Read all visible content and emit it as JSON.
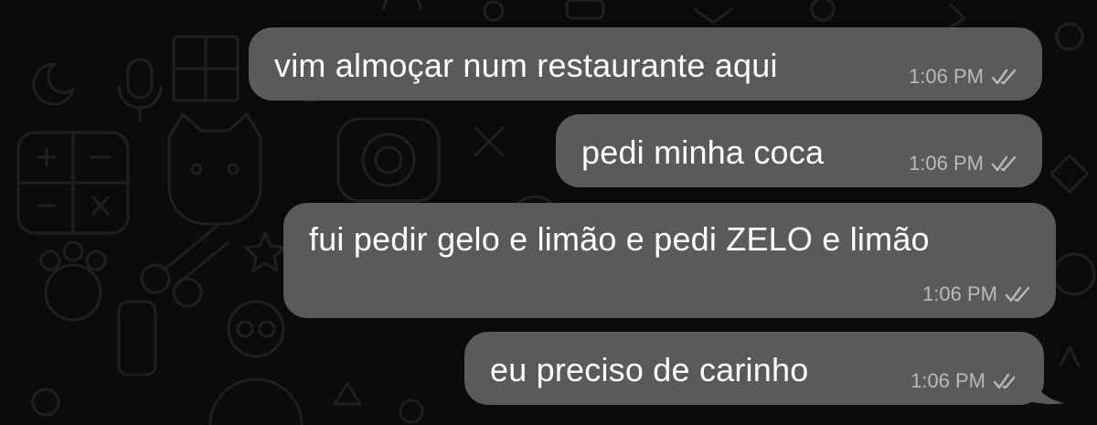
{
  "chat": {
    "messages": [
      {
        "text": "vim almoçar num restaurante aqui",
        "time": "1:06 PM",
        "status_icon": "double-check-icon"
      },
      {
        "text": "pedi minha coca",
        "time": "1:06 PM",
        "status_icon": "double-check-icon"
      },
      {
        "text": "fui pedir gelo e limão e pedi ZELO e limão",
        "time": "1:06 PM",
        "status_icon": "double-check-icon"
      },
      {
        "text": "eu preciso de carinho",
        "time": "1:06 PM",
        "status_icon": "double-check-icon"
      }
    ]
  },
  "colors": {
    "background": "#0b0b0b",
    "bubble": "#5a5a5a",
    "text": "#ffffff",
    "meta": "#b9b9b9",
    "doodle": "#1e1e1e"
  }
}
